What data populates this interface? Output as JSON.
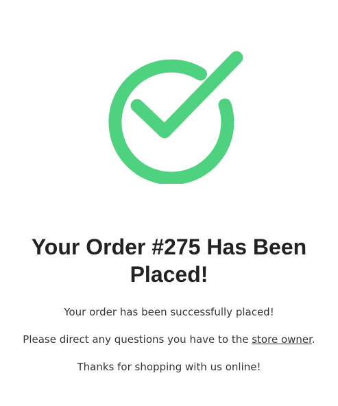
{
  "icon": {
    "name": "checkmark-circle-icon",
    "color": "#4fd27f"
  },
  "title": "Your Order #275 Has Been Placed!",
  "messages": {
    "success": "Your order has been successfully placed!",
    "contact_prefix": "Please direct any questions you have to the ",
    "contact_link": "store owner",
    "contact_suffix": ".",
    "thanks": "Thanks for shopping with us online!"
  }
}
